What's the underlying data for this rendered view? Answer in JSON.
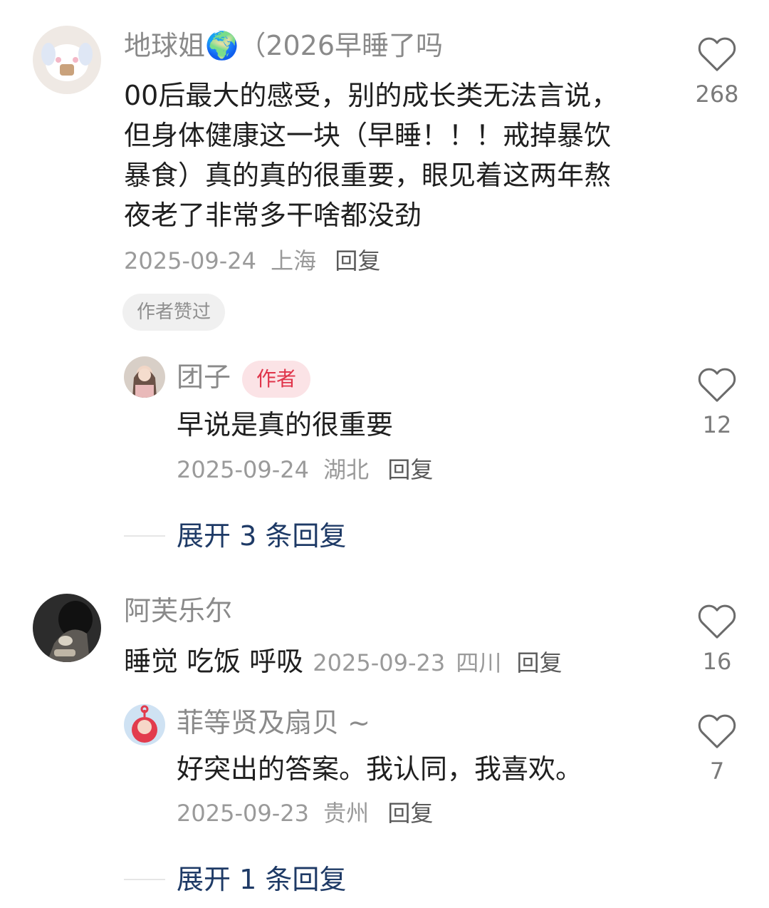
{
  "comments": [
    {
      "name": "地球姐🌍（2026早睡了吗",
      "text": "00后最大的感受，别的成长类无法言说，但身体健康这一块（早睡！！！戒掉暴饮暴食）真的真的很重要，眼见着这两年熬夜老了非常多干啥都没劲",
      "date": "2025-09-24",
      "location": "上海",
      "reply_label": "回复",
      "badge": "作者赞过",
      "likes": "268",
      "avatar_icon": "plush-toy-avatar",
      "replies": [
        {
          "name": "团子",
          "tag": "作者",
          "text": "早说是真的很重要",
          "date": "2025-09-24",
          "location": "湖北",
          "reply_label": "回复",
          "likes": "12",
          "avatar_icon": "girl-photo-avatar"
        }
      ],
      "expand_label": "展开 3 条回复"
    },
    {
      "name": "阿芙乐尔",
      "text": "睡觉 吃饭 呼吸",
      "date": "2025-09-23",
      "location": "四川",
      "reply_label": "回复",
      "likes": "16",
      "avatar_icon": "dark-photo-avatar",
      "replies": [
        {
          "name": "菲等贤及扇贝 ~",
          "text": "好突出的答案。我认同，我喜欢。",
          "date": "2025-09-23",
          "location": "贵州",
          "reply_label": "回复",
          "likes": "7",
          "avatar_icon": "teletubby-avatar"
        }
      ],
      "expand_label": "展开 1 条回复"
    }
  ],
  "colors": {
    "author_tag_bg": "#fbe3e6",
    "author_tag_text": "#e0344a",
    "expand_link": "#1e3a66",
    "heart_outline": "#6b6b6b"
  }
}
